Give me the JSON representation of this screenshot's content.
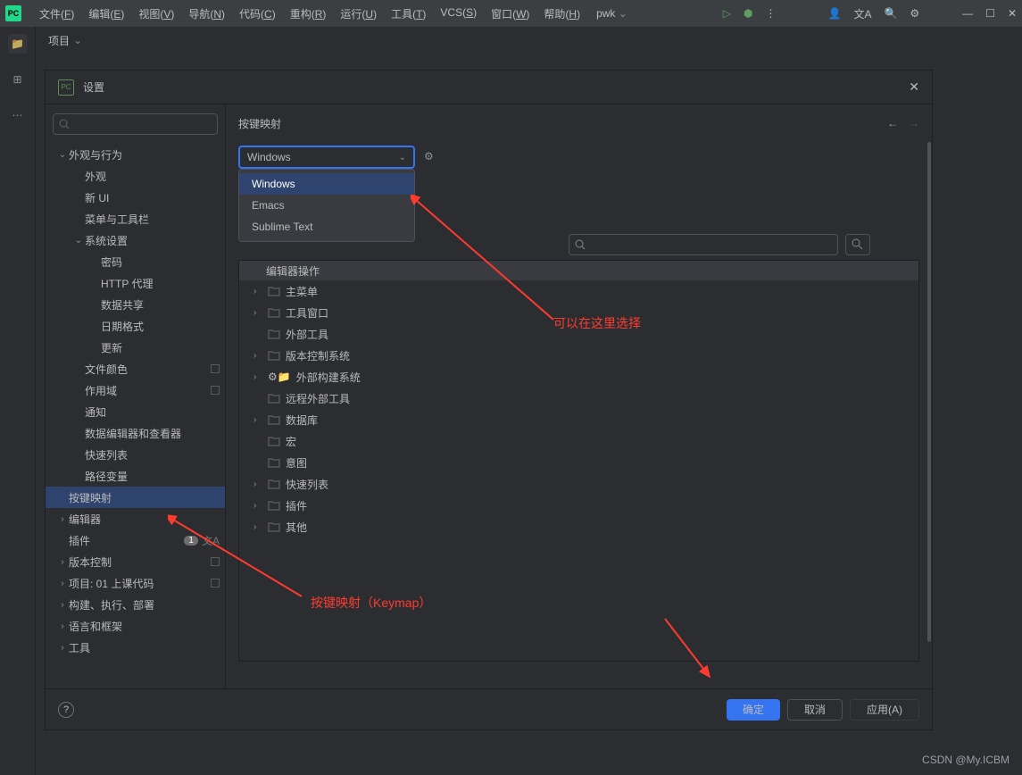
{
  "menubar": {
    "items": [
      {
        "pre": "文件(",
        "u": "F",
        "post": ")"
      },
      {
        "pre": "编辑(",
        "u": "E",
        "post": ")"
      },
      {
        "pre": "视图(",
        "u": "V",
        "post": ")"
      },
      {
        "pre": "导航(",
        "u": "N",
        "post": ")"
      },
      {
        "pre": "代码(",
        "u": "C",
        "post": ")"
      },
      {
        "pre": "重构(",
        "u": "R",
        "post": ")"
      },
      {
        "pre": "运行(",
        "u": "U",
        "post": ")"
      },
      {
        "pre": "工具(",
        "u": "T",
        "post": ")"
      },
      {
        "pre": "VCS(",
        "u": "S",
        "post": ")"
      },
      {
        "pre": "窗口(",
        "u": "W",
        "post": ")"
      },
      {
        "pre": "帮助(",
        "u": "H",
        "post": ")"
      }
    ],
    "project": "pwk"
  },
  "projectLabel": "项目",
  "dialog": {
    "title": "设置",
    "crumbTitle": "按键映射",
    "combo": {
      "value": "Windows",
      "options": [
        "Windows",
        "Emacs",
        "Sublime Text"
      ]
    },
    "sidebar": [
      {
        "lvl": 0,
        "chev": "v",
        "label": "外观与行为"
      },
      {
        "lvl": 1,
        "label": "外观"
      },
      {
        "lvl": 1,
        "label": "新 UI"
      },
      {
        "lvl": 1,
        "label": "菜单与工具栏"
      },
      {
        "lvl": 1,
        "chev": "v",
        "label": "系统设置"
      },
      {
        "lvl": 2,
        "label": "密码"
      },
      {
        "lvl": 2,
        "label": "HTTP 代理"
      },
      {
        "lvl": 2,
        "label": "数据共享"
      },
      {
        "lvl": 2,
        "label": "日期格式"
      },
      {
        "lvl": 2,
        "label": "更新"
      },
      {
        "lvl": 1,
        "label": "文件颜色",
        "sq": true
      },
      {
        "lvl": 1,
        "label": "作用域",
        "sq": true
      },
      {
        "lvl": 1,
        "label": "通知"
      },
      {
        "lvl": 1,
        "label": "数据编辑器和查看器"
      },
      {
        "lvl": 1,
        "label": "快速列表"
      },
      {
        "lvl": 1,
        "label": "路径变量"
      },
      {
        "lvl": 0,
        "label": "按键映射",
        "selected": true
      },
      {
        "lvl": 0,
        "chev": ">",
        "label": "编辑器"
      },
      {
        "lvl": 0,
        "label": "插件",
        "badge": "1",
        "lang": true
      },
      {
        "lvl": 0,
        "chev": ">",
        "label": "版本控制",
        "sq": true
      },
      {
        "lvl": 0,
        "chev": ">",
        "label": "项目: 01 上课代码",
        "sq": true
      },
      {
        "lvl": 0,
        "chev": ">",
        "label": "构建、执行、部署"
      },
      {
        "lvl": 0,
        "chev": ">",
        "label": "语言和框架"
      },
      {
        "lvl": 0,
        "chev": ">",
        "label": "工具"
      }
    ],
    "actionHeader": "编辑器操作",
    "actions": [
      {
        "chev": ">",
        "folder": true,
        "label": "主菜单"
      },
      {
        "chev": ">",
        "folder": true,
        "label": "工具窗口"
      },
      {
        "folder": true,
        "label": "外部工具"
      },
      {
        "chev": ">",
        "folder": true,
        "label": "版本控制系统"
      },
      {
        "chev": ">",
        "gear": true,
        "label": "外部构建系统"
      },
      {
        "folder": true,
        "label": "远程外部工具"
      },
      {
        "chev": ">",
        "folder": true,
        "label": "数据库"
      },
      {
        "folder": true,
        "label": "宏"
      },
      {
        "folder": true,
        "label": "意图"
      },
      {
        "chev": ">",
        "folder": true,
        "label": "快速列表"
      },
      {
        "chev": ">",
        "folder": true,
        "label": "插件"
      },
      {
        "chev": ">",
        "folder": true,
        "label": "其他"
      }
    ],
    "footer": {
      "ok": "确定",
      "cancel": "取消",
      "apply": "应用(A)"
    }
  },
  "annotations": {
    "a1": "可以在这里选择",
    "a2": "按键映射（Keymap）"
  },
  "watermark": "CSDN @My.ICBM"
}
